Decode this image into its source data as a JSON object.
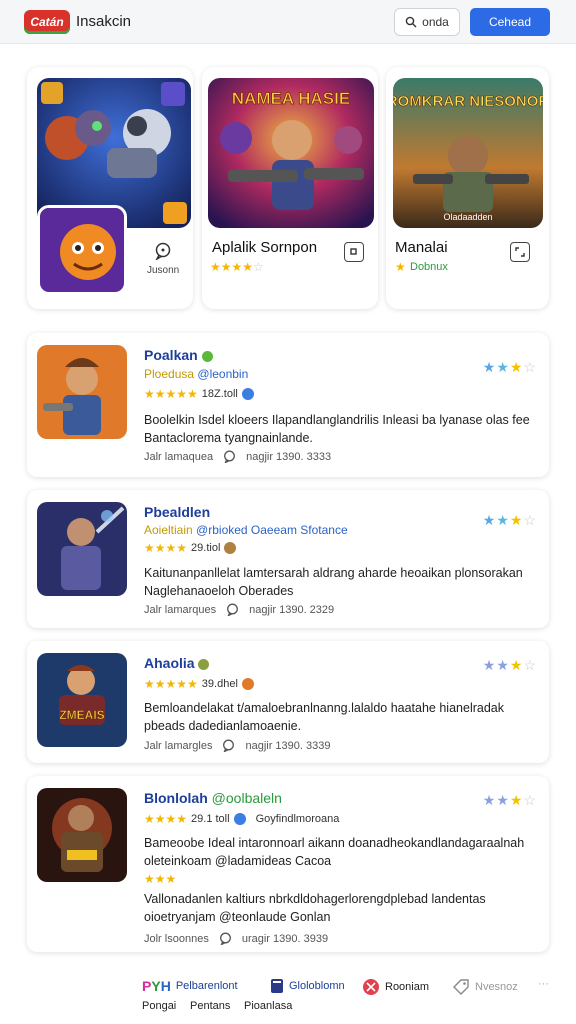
{
  "header": {
    "logo_text": "Catán",
    "title": "Insakcin",
    "search_label": "onda",
    "primary_label": "Cehead",
    "accent": "#2c6ae6"
  },
  "featured": [
    {
      "art_label": "",
      "side_label": "Jusonn",
      "icon": "chat-bubble-icon"
    },
    {
      "art_label": "NAMEA HASIE",
      "title": "Aplalik Sornpon",
      "stars": 4,
      "icon": "external-box-icon"
    },
    {
      "art_label": "ROMKRAR NIESONOR",
      "art_caption": "Oladaadden",
      "title": "Manalai",
      "sub": "Dobnux",
      "stars": 1,
      "icon": "expand-box-icon"
    }
  ],
  "list": [
    {
      "title": "Poalkan",
      "sub_a": "Ploedusa",
      "sub_b": "@leonbin",
      "rating_text": "18Z.toll",
      "desc": "Boolelkin Isdel kloeers Ilapandlanglandrilis Inleasi ba lyanase olas fee Bantaclorema tyangnainlande.",
      "meta_a": "Jalr lamaquea",
      "meta_b": "nagjir 1390. 3333",
      "right_stars": 3
    },
    {
      "title": "Pbealdlen",
      "sub_a": "Aoieltiain",
      "sub_b": "@rbioked Oaeeam Sfotance",
      "rating_text": "29.tiol",
      "desc": "Kaitunanpanllelat lamtersarah aldrang aharde heoaikan plonsorakan Naglehanaoeloh Oberades",
      "meta_a": "Jalr lamarques",
      "meta_b": "nagjir 1390. 2329",
      "right_stars": 3
    },
    {
      "title": "Ahaolia",
      "rating_text": "39.dhel",
      "desc": "Bemloandelakat t/amaloebranlnanng.lalaldo haatahe hianelradak pbeads dadedianlamoaenie.",
      "meta_a": "Jalr lamargles",
      "meta_b": "nagjir 1390. 3339",
      "right_stars": 3,
      "art_label": "ZMEAIS"
    },
    {
      "title": "Blonlolah",
      "title_b": "@oolbaleln",
      "rating_text": "29.1 toll",
      "rating_b": "Goyfindlmoroana",
      "desc": "Bameoobe Ideal intaronnoarl aikann doanadheokandlandagaraalnah oleteinkoam @ladamideas Cacoa",
      "desc2": "Vallonadanlen kaltiurs nbrkdldohagerlorengdplebad landentas oioetryanjam @teonlaude Gonlan",
      "meta_a": "Jolr lsoonnes",
      "meta_b": "uragir 1390. 3939",
      "right_stars": 3
    }
  ],
  "bottom_nav": [
    {
      "label": "Pelbarenlont",
      "sub": "Pongai",
      "logo": "PYH"
    },
    {
      "label": "Gloloblomn",
      "sub": "Pentans"
    },
    {
      "label": "Rooniam",
      "sub": "Pioanlasa"
    },
    {
      "label": "Nvesnoz",
      "sub": ""
    }
  ]
}
